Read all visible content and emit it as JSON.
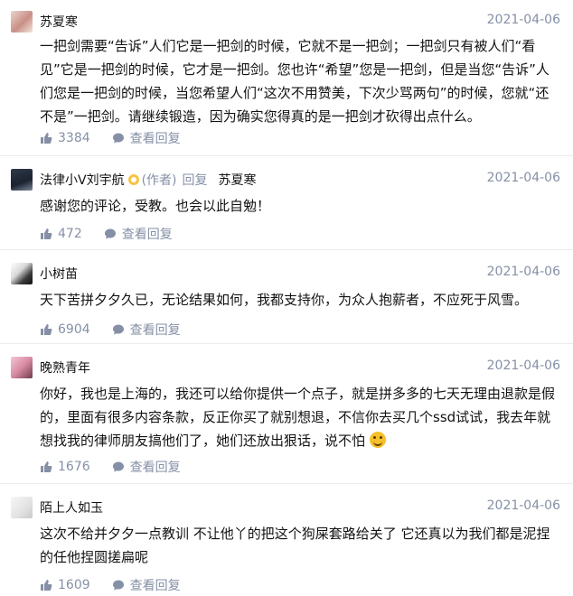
{
  "comments": [
    {
      "author": "苏夏寒",
      "date": "2021-04-06",
      "text": "一把剑需要“告诉”人们它是一把剑的时候，它就不是一把剑；一把剑只有被人们“看见”它是一把剑的时候，它才是一把剑。您也许“希望”您是一把剑，但是当您“告诉”人们您是一把剑的时候，当您希望人们“这次不用赞美，下次少骂两句”的时候，您就“还不是”一把剑。请继续锻造，因为确实您得真的是一把剑才砍得出点什么。",
      "likes": "3384",
      "view_replies": "查看回复"
    },
    {
      "author": "法律小V刘宇航",
      "role": "(作者)",
      "reply_label": "回复",
      "reply_to": "苏夏寒",
      "date": "2021-04-06",
      "text": "感谢您的评论，受教。也会以此自勉！",
      "likes": "472",
      "view_replies": "查看回复"
    },
    {
      "author": "小树苗",
      "date": "2021-04-06",
      "text": "天下苦拼夕夕久已，无论结果如何，我都支持你，为众人抱薪者，不应死于风雪。",
      "likes": "6904",
      "view_replies": "查看回复"
    },
    {
      "author": "晚熟青年",
      "date": "2021-04-06",
      "text": "你好，我也是上海的，我还可以给你提供一个点子，就是拼多多的七天无理由退款是假的，里面有很多内容条款，反正你买了就别想退，不信你去买几个ssd试试，我去年就想找我的律师朋友搞他们了，她们还放出狠话，说不怕",
      "likes": "1676",
      "view_replies": "查看回复"
    },
    {
      "author": "陌上人如玉",
      "date": "2021-04-06",
      "text": "这次不给并夕夕一点教训 不让他丫的把这个狗屎套路给关了 它还真以为我们都是泥捏的任他捏圆搓扁呢",
      "likes": "1609",
      "view_replies": "查看回复"
    }
  ]
}
